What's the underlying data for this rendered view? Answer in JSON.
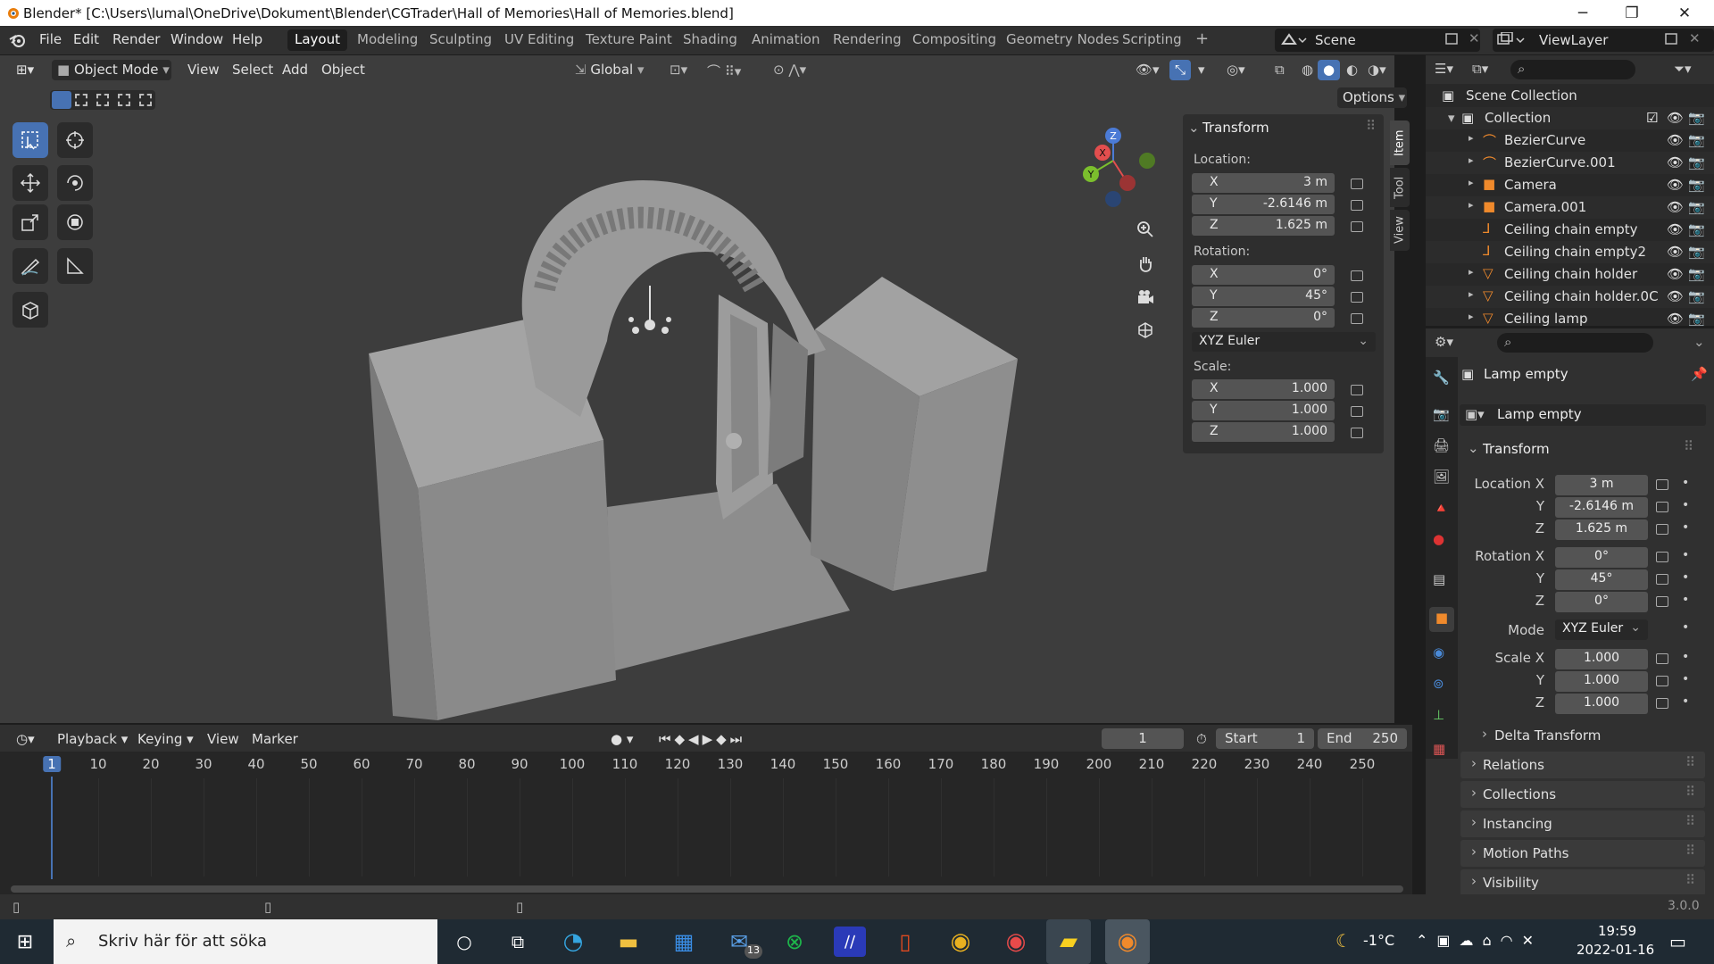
{
  "window": {
    "title": "Blender* [C:\\Users\\lumal\\OneDrive\\Dokument\\Blender\\CGTrader\\Hall of Memories\\Hall of Memories.blend]",
    "minimize": "─",
    "maximize": "❐",
    "close": "✕"
  },
  "menu": [
    "File",
    "Edit",
    "Render",
    "Window",
    "Help"
  ],
  "workspaces": [
    "Layout",
    "Modeling",
    "Sculpting",
    "UV Editing",
    "Texture Paint",
    "Shading",
    "Animation",
    "Rendering",
    "Compositing",
    "Geometry Nodes",
    "Scripting"
  ],
  "workspace_add": "+",
  "scene": "Scene",
  "view_layer": "ViewLayer",
  "viewport_header": {
    "mode": "Object Mode",
    "menus": [
      "View",
      "Select",
      "Add",
      "Object"
    ],
    "orientation": "Global",
    "options": "Options"
  },
  "npanel": {
    "header": "Transform",
    "location_label": "Location:",
    "location": [
      {
        "k": "X",
        "v": "3 m"
      },
      {
        "k": "Y",
        "v": "-2.6146 m"
      },
      {
        "k": "Z",
        "v": "1.625 m"
      }
    ],
    "rotation_label": "Rotation:",
    "rotation": [
      {
        "k": "X",
        "v": "0°"
      },
      {
        "k": "Y",
        "v": "45°"
      },
      {
        "k": "Z",
        "v": "0°"
      }
    ],
    "rotation_mode": "XYZ Euler",
    "scale_label": "Scale:",
    "scale": [
      {
        "k": "X",
        "v": "1.000"
      },
      {
        "k": "Y",
        "v": "1.000"
      },
      {
        "k": "Z",
        "v": "1.000"
      }
    ],
    "tabs": [
      "Item",
      "Tool",
      "View"
    ]
  },
  "gizmo": {
    "x": "X",
    "y": "Y",
    "z": "Z"
  },
  "outliner": {
    "root": "Scene Collection",
    "collection": "Collection",
    "items": [
      "BezierCurve",
      "BezierCurve.001",
      "Camera",
      "Camera.001",
      "Ceiling chain empty",
      "Ceiling chain empty2",
      "Ceiling chain holder",
      "Ceiling chain holder.0C",
      "Ceiling lamp"
    ]
  },
  "properties": {
    "object_name": "Lamp empty",
    "object_field": "Lamp empty",
    "transform_header": "Transform",
    "location_label": "Location X",
    "location": [
      "3 m",
      "-2.6146 m",
      "1.625 m"
    ],
    "rotation_label": "Rotation X",
    "rotation": [
      "0°",
      "45°",
      "0°"
    ],
    "mode_label": "Mode",
    "mode": "XYZ Euler",
    "scale_label": "Scale X",
    "scale": [
      "1.000",
      "1.000",
      "1.000"
    ],
    "axis_y": "Y",
    "axis_z": "Z",
    "sections": [
      "Delta Transform",
      "Relations",
      "Collections",
      "Instancing",
      "Motion Paths",
      "Visibility"
    ]
  },
  "timeline": {
    "menus": [
      "Playback",
      "Keying",
      "View",
      "Marker"
    ],
    "current_frame": "1",
    "start_label": "Start",
    "start": "1",
    "end_label": "End",
    "end": "250",
    "ticks": [
      "1",
      "10",
      "20",
      "30",
      "40",
      "50",
      "60",
      "70",
      "80",
      "90",
      "100",
      "110",
      "120",
      "130",
      "140",
      "150",
      "160",
      "170",
      "180",
      "190",
      "200",
      "210",
      "220",
      "230",
      "240",
      "250"
    ]
  },
  "status": {
    "version": "3.0.0"
  },
  "taskbar": {
    "search_placeholder": "Skriv här för att söka",
    "mail_badge": "13",
    "temperature": "-1°C",
    "time": "19:59",
    "date": "2022-01-16"
  }
}
